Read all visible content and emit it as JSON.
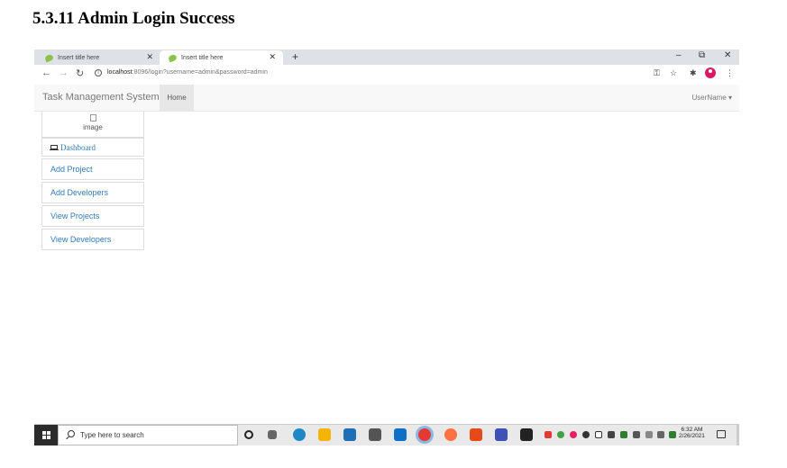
{
  "document": {
    "heading": "5.3.11 Admin Login Success"
  },
  "browser": {
    "tabs": [
      {
        "title": "Insert title here",
        "active": false
      },
      {
        "title": "Insert title here",
        "active": true
      }
    ],
    "new_tab": "+",
    "window_controls": {
      "minimize": "–",
      "maximize": "⧉",
      "close": "✕"
    },
    "address": {
      "host": "localhost",
      "rest": ":8096/login?username=admin&password=admin"
    }
  },
  "app": {
    "brand": "Task Management System",
    "nav": {
      "home": "Home",
      "user_menu": "UserName ▾"
    },
    "sidebar": {
      "image_alt": "image",
      "items": [
        {
          "label": "Dashboard"
        },
        {
          "label": "Add Project"
        },
        {
          "label": "Add Developers"
        },
        {
          "label": "View Projects"
        },
        {
          "label": "View Developers"
        }
      ]
    }
  },
  "taskbar": {
    "search_placeholder": "Type here to search",
    "time": "6:32 AM",
    "date": "2/26/2021"
  },
  "colors": {
    "link": "#337ab7",
    "tabstrip": "#dee1e6",
    "taskbar_start": "#2b2b2b"
  }
}
